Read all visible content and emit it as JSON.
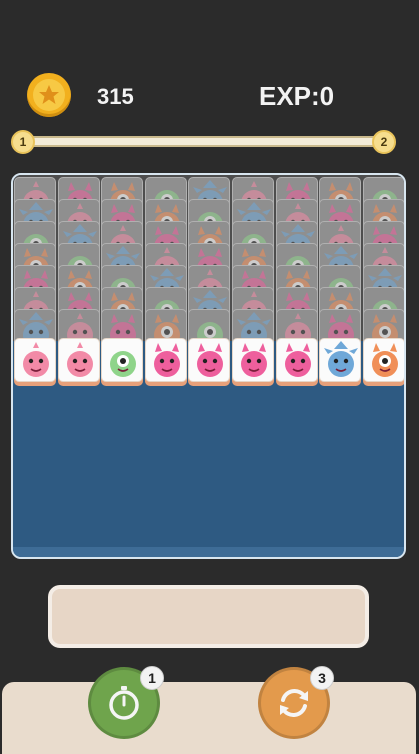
{
  "hud": {
    "coins": "315",
    "exp": "EXP:0",
    "level_start": "1",
    "level_end": "2",
    "progress": 0.0
  },
  "board": {
    "columns": 9,
    "back_rows": 7,
    "front_row": [
      "pink-ghost",
      "pink-ghost",
      "green-cyclops",
      "magenta-horned",
      "magenta-horned",
      "magenta-horned",
      "magenta-horned",
      "blue-horned",
      "orange-cyclops"
    ],
    "colors": {
      "pink": "#f28aa7",
      "green": "#8fd48a",
      "magenta": "#ee5f9d",
      "blue": "#6fa8d8",
      "orange": "#f08f58"
    }
  },
  "powerups": {
    "timer": {
      "icon": "stopwatch-icon",
      "count": "1"
    },
    "refresh": {
      "icon": "refresh-icon",
      "count": "3"
    }
  }
}
